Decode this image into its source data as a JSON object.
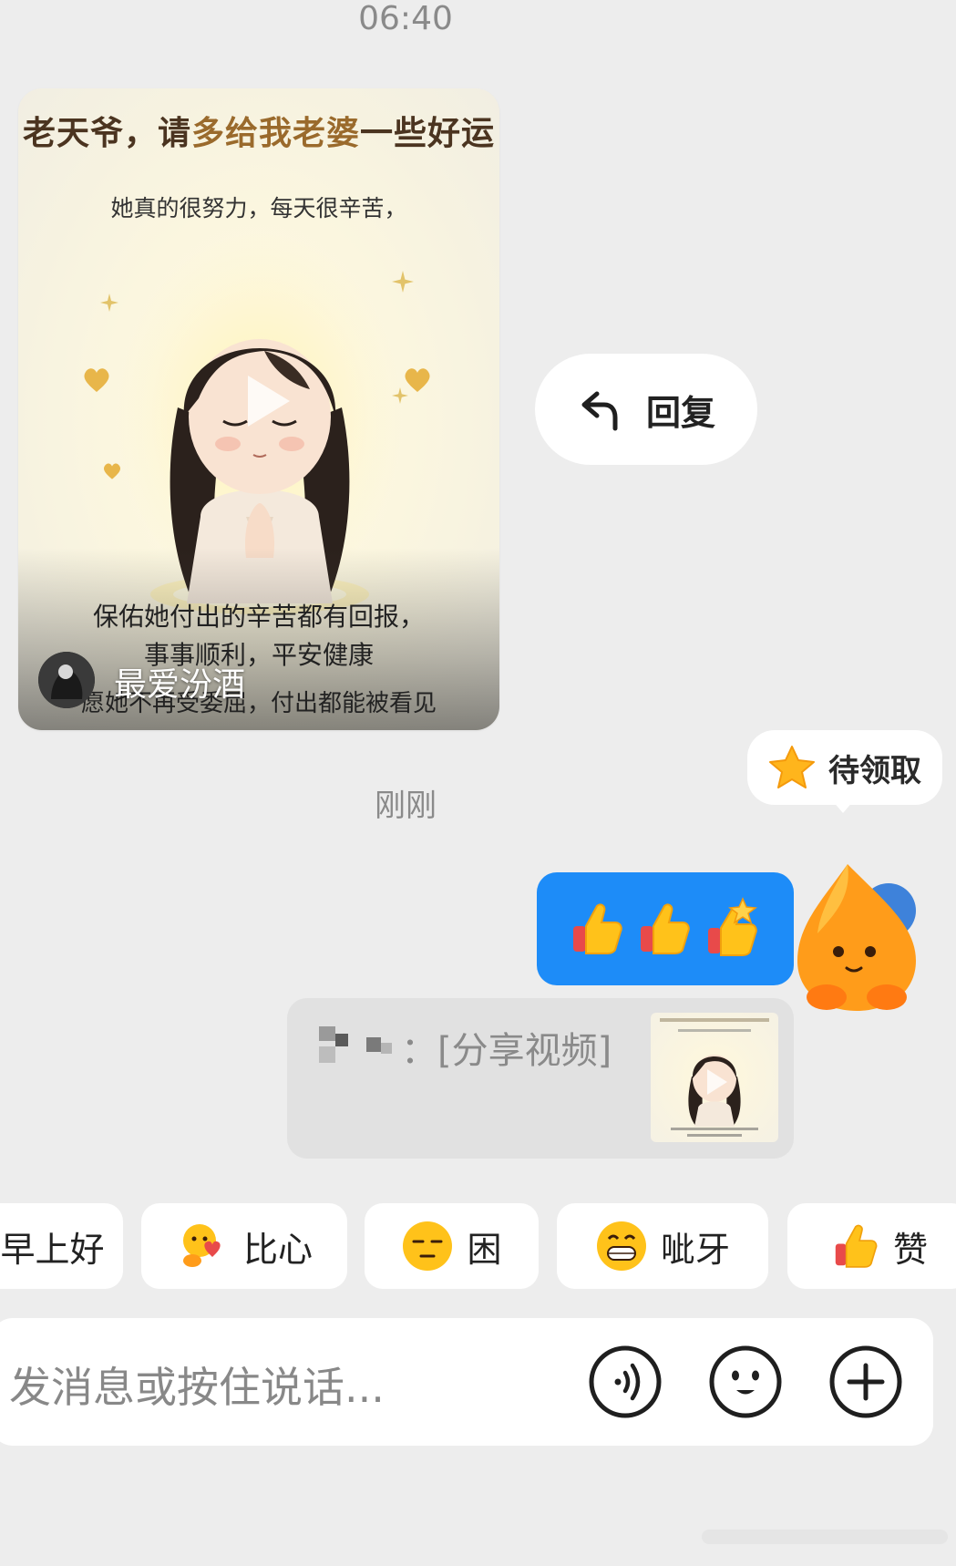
{
  "status": {
    "time": "06:40"
  },
  "video_card": {
    "title_part1": "老天爷，请",
    "title_part2": "多给我老婆",
    "title_part3": "一些好运",
    "subtitle": "她真的很努力，每天很辛苦，",
    "line1": "保佑她付出的辛苦都有回报，",
    "line2": "事事顺利，平安健康",
    "line3": "愿她不再受委屈，付出都能被看见",
    "author": "最爱汾酒"
  },
  "reply_action": {
    "label": "回复",
    "icon": "reply-arrow-icon"
  },
  "timestamp": "刚刚",
  "pending_badge": {
    "label": "待领取",
    "icon": "star-icon"
  },
  "message": {
    "emojis": [
      "thumbs-up-emoji",
      "thumbs-up-emoji",
      "thumbs-up-star-emoji"
    ]
  },
  "quote": {
    "text": "：[分享视频]"
  },
  "quick_replies": [
    {
      "label": "早上好",
      "icon": ""
    },
    {
      "label": "比心",
      "icon": "heart-hug-emoji"
    },
    {
      "label": "困",
      "icon": "sleepy-emoji"
    },
    {
      "label": "呲牙",
      "icon": "grin-emoji"
    },
    {
      "label": "赞",
      "icon": "thumbs-up-emoji"
    }
  ],
  "input": {
    "placeholder": "发消息或按住说话..."
  },
  "input_icons": [
    "voice-icon",
    "emoji-icon",
    "plus-icon"
  ],
  "colors": {
    "bubble_blue": "#1d8cf8",
    "background": "#ededed"
  }
}
